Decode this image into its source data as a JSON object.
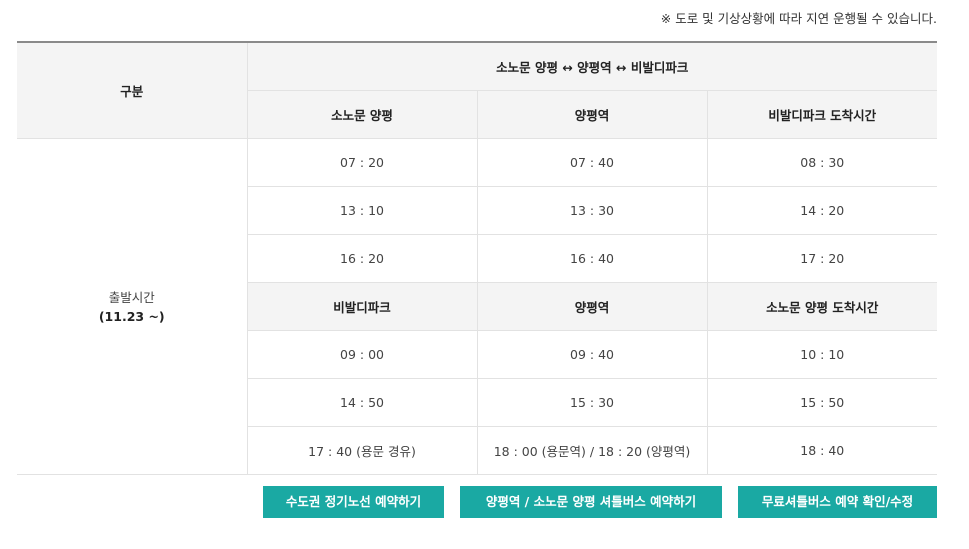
{
  "notice": "※ 도로 및 기상상황에 따라 지연 운행될 수 있습니다.",
  "table": {
    "corner_label": "구분",
    "route_title": "소노문 양평 ↔ 양평역 ↔ 비발디파크",
    "depart_label": "출발시간",
    "depart_period": "(11.23 ~)",
    "outbound": {
      "headers": [
        "소노문 양평",
        "양평역",
        "비발디파크 도착시간"
      ],
      "rows": [
        [
          "07 : 20",
          "07 : 40",
          "08 : 30"
        ],
        [
          "13 : 10",
          "13 : 30",
          "14 : 20"
        ],
        [
          "16 : 20",
          "16 : 40",
          "17 : 20"
        ]
      ]
    },
    "inbound": {
      "headers": [
        "비발디파크",
        "양평역",
        "소노문 양평 도착시간"
      ],
      "rows": [
        [
          "09 : 00",
          "09 : 40",
          "10 : 10"
        ],
        [
          "14 : 50",
          "15 : 30",
          "15 : 50"
        ],
        [
          "17 : 40 (용문 경유)",
          "18 : 00 (용문역) / 18 : 20 (양평역)",
          "18 : 40"
        ]
      ]
    }
  },
  "buttons": {
    "metro_reserve": "수도권 정기노선 예약하기",
    "shuttle_reserve": "양평역 / 소노문 양평 셔틀버스 예약하기",
    "free_check": "무료셔틀버스 예약 확인/수정"
  },
  "colors": {
    "button_bg": "#1aa9a3",
    "header_bg": "#f4f4f4",
    "top_border": "#8a8a8a"
  }
}
